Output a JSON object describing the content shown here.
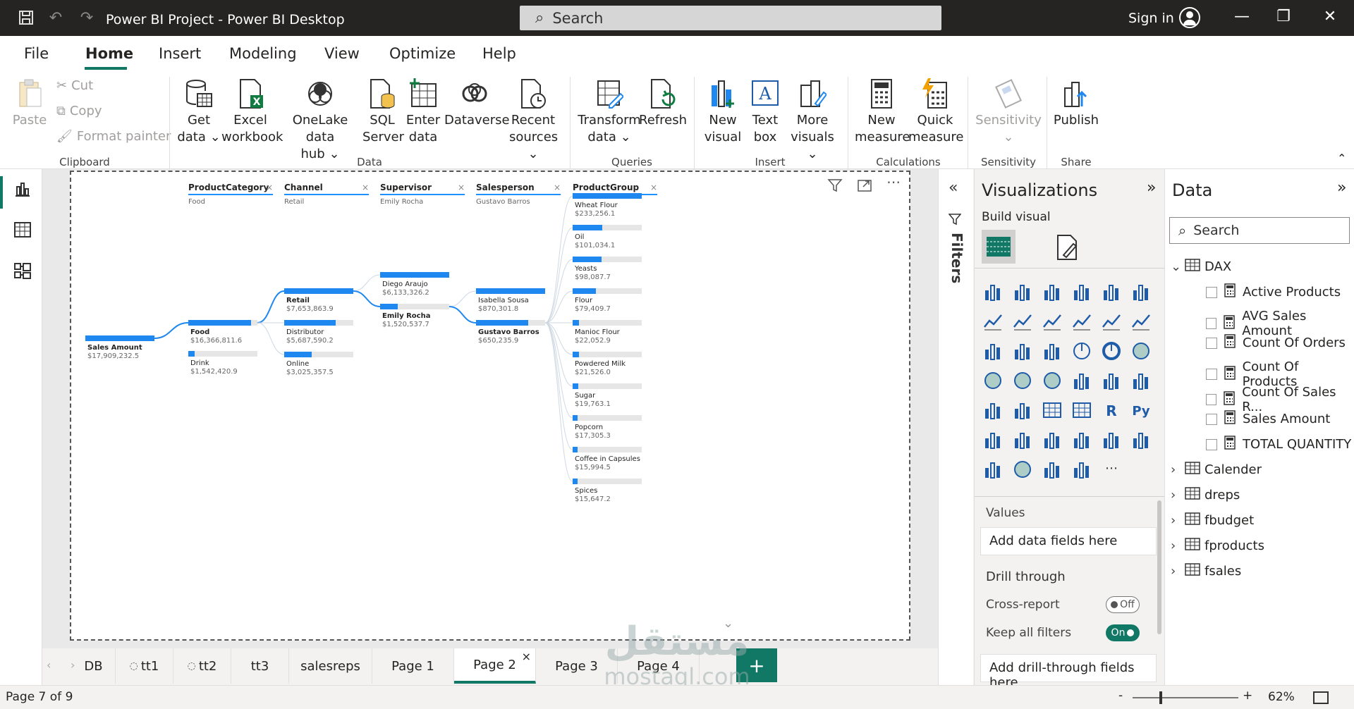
{
  "window": {
    "title": "Power BI Project - Power BI Desktop",
    "search": "Search",
    "sign_in": "Sign in"
  },
  "menu": [
    "File",
    "Home",
    "Insert",
    "Modeling",
    "View",
    "Optimize",
    "Help"
  ],
  "ribbon": {
    "paste": "Paste",
    "cut": "Cut",
    "copy": "Copy",
    "format_painter": "Format painter",
    "get_data_1": "Get",
    "get_data_2": "data",
    "excel_1": "Excel",
    "excel_2": "workbook",
    "onelake_1": "OneLake data",
    "onelake_2": "hub",
    "sql_1": "SQL",
    "sql_2": "Server",
    "enter_1": "Enter",
    "enter_2": "data",
    "dataverse": "Dataverse",
    "recent_1": "Recent",
    "recent_2": "sources",
    "transform_1": "Transform",
    "transform_2": "data",
    "refresh": "Refresh",
    "new_visual_1": "New",
    "new_visual_2": "visual",
    "text_box_1": "Text",
    "text_box_2": "box",
    "more_visuals_1": "More",
    "more_visuals_2": "visuals",
    "new_measure_1": "New",
    "new_measure_2": "measure",
    "quick_measure_1": "Quick",
    "quick_measure_2": "measure",
    "sensitivity": "Sensitivity",
    "publish": "Publish",
    "groups": {
      "clipboard": "Clipboard",
      "data": "Data",
      "queries": "Queries",
      "insert": "Insert",
      "calculations": "Calculations",
      "sensitivity": "Sensitivity",
      "share": "Share"
    }
  },
  "visual": {
    "headers": [
      {
        "title": "ProductCategory",
        "sub": "Food"
      },
      {
        "title": "Channel",
        "sub": "Retail"
      },
      {
        "title": "Supervisor",
        "sub": "Emily Rocha"
      },
      {
        "title": "Salesperson",
        "sub": "Gustavo Barros"
      },
      {
        "title": "ProductGroup",
        "sub": ""
      }
    ],
    "root": {
      "label": "Sales Amount",
      "value": "$17,909,232.5"
    },
    "category": [
      {
        "label": "Food",
        "value": "$16,366,811.6",
        "frac": 0.91
      },
      {
        "label": "Drink",
        "value": "$1,542,420.9",
        "frac": 0.09
      }
    ],
    "channel": [
      {
        "label": "Retail",
        "value": "$7,653,863.9",
        "frac": 1.0
      },
      {
        "label": "Distributor",
        "value": "$5,687,590.2",
        "frac": 0.74
      },
      {
        "label": "Online",
        "value": "$3,025,357.5",
        "frac": 0.4
      }
    ],
    "supervisor": [
      {
        "label": "Diego Araujo",
        "value": "$6,133,326.2",
        "frac": 1.0
      },
      {
        "label": "Emily Rocha",
        "value": "$1,520,537.7",
        "frac": 0.25
      }
    ],
    "salesperson": [
      {
        "label": "Isabella Sousa",
        "value": "$870,301.8",
        "frac": 1.0
      },
      {
        "label": "Gustavo Barros",
        "value": "$650,235.9",
        "frac": 0.75
      }
    ],
    "groups": [
      {
        "label": "Wheat Flour",
        "value": "$233,256.1",
        "frac": 1.0
      },
      {
        "label": "Oil",
        "value": "$101,034.1",
        "frac": 0.43
      },
      {
        "label": "Yeasts",
        "value": "$98,087.7",
        "frac": 0.42
      },
      {
        "label": "Flour",
        "value": "$79,409.7",
        "frac": 0.34
      },
      {
        "label": "Manioc Flour",
        "value": "$22,052.9",
        "frac": 0.09
      },
      {
        "label": "Powdered Milk",
        "value": "$21,526.0",
        "frac": 0.09
      },
      {
        "label": "Sugar",
        "value": "$19,763.1",
        "frac": 0.08
      },
      {
        "label": "Popcorn",
        "value": "$17,305.3",
        "frac": 0.07
      },
      {
        "label": "Coffee in Capsules",
        "value": "$15,994.5",
        "frac": 0.07
      },
      {
        "label": "Spices",
        "value": "$15,647.2",
        "frac": 0.07
      }
    ]
  },
  "filters_label": "Filters",
  "viz_pane": {
    "title": "Visualizations",
    "build_visual": "Build visual",
    "values": "Values",
    "add_data_fields": "Add data fields here",
    "drill_through": "Drill through",
    "cross_report": "Cross-report",
    "cross_report_state": "Off",
    "keep_all_filters": "Keep all filters",
    "keep_all_filters_state": "On",
    "add_drill_fields": "Add drill-through fields here"
  },
  "data_pane": {
    "title": "Data",
    "search": "Search",
    "tables": [
      {
        "name": "DAX",
        "expanded": true,
        "fields": [
          "Active Products",
          "AVG Sales Amount",
          "Count Of Orders",
          "Count Of Products",
          "Count Of Sales R...",
          "Sales Amount",
          "TOTAL QUANTITY"
        ]
      },
      {
        "name": "Calender",
        "expanded": false
      },
      {
        "name": "dreps",
        "expanded": false
      },
      {
        "name": "fbudget",
        "expanded": false
      },
      {
        "name": "fproducts",
        "expanded": false
      },
      {
        "name": "fsales",
        "expanded": false
      }
    ]
  },
  "tabs": [
    "DB",
    "tt1",
    "tt2",
    "tt3",
    "salesreps",
    "Page 1",
    "Page 2",
    "Page 3",
    "Page 4"
  ],
  "active_tab": "Page 2",
  "status": {
    "page": "Page 7 of 9",
    "zoom": "62%"
  },
  "watermark": {
    "line1": "مستقل",
    "line2": "mostaql.com"
  },
  "colors": {
    "accent": "#117865",
    "bar": "#1e88f0",
    "titlebar": "#252423"
  }
}
